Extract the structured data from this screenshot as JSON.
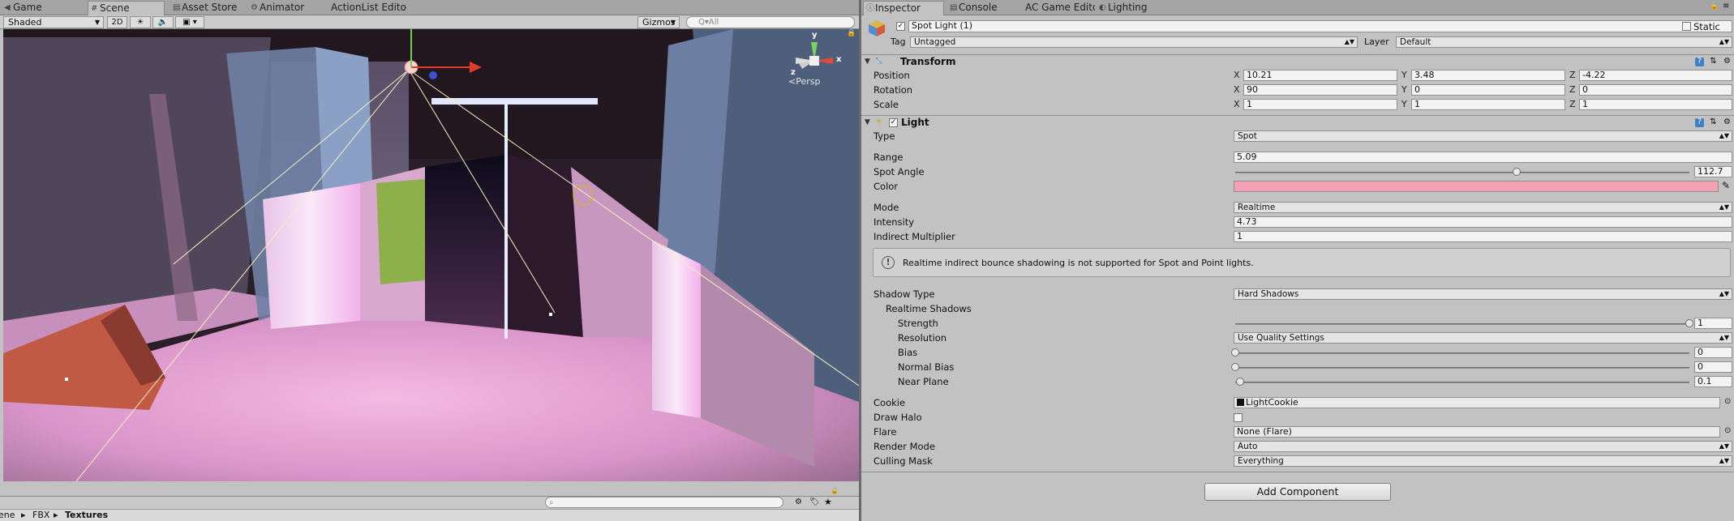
{
  "left_tabs": [
    {
      "label": "Game",
      "icon": "game-icon",
      "active": false
    },
    {
      "label": "Scene",
      "icon": "scene-icon",
      "active": true
    },
    {
      "label": "Asset Store",
      "icon": "asset-store-icon",
      "active": false
    },
    {
      "label": "Animator",
      "icon": "animator-icon",
      "active": false
    },
    {
      "label": "ActionList Edito",
      "icon": "",
      "active": false
    }
  ],
  "scene_toolbar": {
    "draw_mode": "Shaded",
    "mode_2d": "2D",
    "gizmos": "Gizmos",
    "search_placeholder": "Q▾All"
  },
  "scene_view": {
    "persp_label": "<Persp",
    "axis_x": "x",
    "axis_y": "y",
    "axis_z": "z"
  },
  "breadcrumb": [
    "ene",
    "FBX",
    "Textures"
  ],
  "breadcrumb_sep": "▸",
  "right_tabs": [
    {
      "label": "Inspector",
      "icon": "inspector-icon",
      "active": true
    },
    {
      "label": "Console",
      "icon": "console-icon",
      "active": false
    },
    {
      "label": "AC Game Edito",
      "icon": "",
      "active": false
    },
    {
      "label": "Lighting",
      "icon": "lighting-icon",
      "active": false
    }
  ],
  "object": {
    "name": "Spot Light (1)",
    "static_label": "Static",
    "tag_label": "Tag",
    "tag_value": "Untagged",
    "layer_label": "Layer",
    "layer_value": "Default"
  },
  "transform": {
    "title": "Transform",
    "rows": [
      {
        "label": "Position",
        "x": "10.21",
        "y": "3.48",
        "z": "-4.22"
      },
      {
        "label": "Rotation",
        "x": "90",
        "y": "0",
        "z": "0"
      },
      {
        "label": "Scale",
        "x": "1",
        "y": "1",
        "z": "1"
      }
    ],
    "axis_x": "X",
    "axis_y": "Y",
    "axis_z": "Z"
  },
  "light": {
    "title": "Light",
    "type_label": "Type",
    "type_value": "Spot",
    "range_label": "Range",
    "range_value": "5.09",
    "spot_angle_label": "Spot Angle",
    "spot_angle_value": "112.7",
    "spot_angle_fraction": 0.62,
    "color_label": "Color",
    "color_value": "#f4a1b5",
    "mode_label": "Mode",
    "mode_value": "Realtime",
    "intensity_label": "Intensity",
    "intensity_value": "4.73",
    "indirect_label": "Indirect Multiplier",
    "indirect_value": "1",
    "help_text": "Realtime indirect bounce shadowing is not supported for Spot and Point lights.",
    "shadow_type_label": "Shadow Type",
    "shadow_type_value": "Hard Shadows",
    "realtime_shadows_label": "Realtime Shadows",
    "strength_label": "Strength",
    "strength_value": "1",
    "strength_fraction": 1.0,
    "resolution_label": "Resolution",
    "resolution_value": "Use Quality Settings",
    "bias_label": "Bias",
    "bias_value": "0",
    "bias_fraction": 0.0,
    "normal_bias_label": "Normal Bias",
    "normal_bias_value": "0",
    "normal_bias_fraction": 0.0,
    "near_plane_label": "Near Plane",
    "near_plane_value": "0.1",
    "near_plane_fraction": 0.01,
    "cookie_label": "Cookie",
    "cookie_value": "LightCookie",
    "draw_halo_label": "Draw Halo",
    "flare_label": "Flare",
    "flare_value": "None (Flare)",
    "render_mode_label": "Render Mode",
    "render_mode_value": "Auto",
    "culling_mask_label": "Culling Mask",
    "culling_mask_value": "Everything"
  },
  "add_component": "Add Component"
}
